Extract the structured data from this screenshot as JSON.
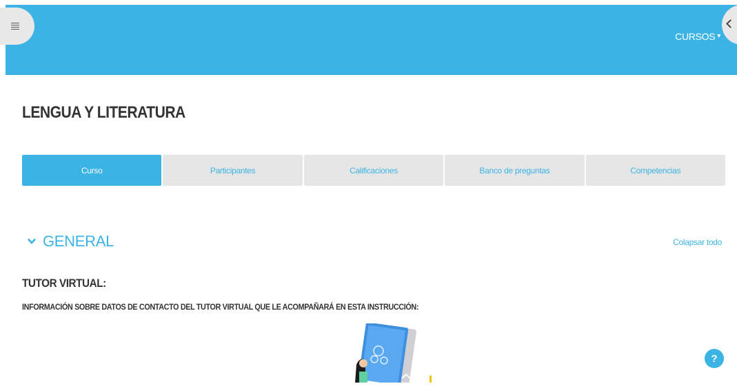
{
  "header": {
    "menu_icon": "list-icon",
    "courses_menu_label": "CURSOS",
    "courses_chevron_icon": "chevron-down-icon",
    "side_handle_icon": "chevron-left-icon",
    "brand_color": "#3bb4e5"
  },
  "page": {
    "title": "LENGUA Y LITERATURA"
  },
  "tabs": [
    {
      "label": "Curso",
      "active": true
    },
    {
      "label": "Participantes",
      "active": false
    },
    {
      "label": "Calificaciones",
      "active": false
    },
    {
      "label": "Banco de preguntas",
      "active": false
    },
    {
      "label": "Competencias",
      "active": false
    }
  ],
  "section": {
    "title": "GENERAL",
    "collapse_all": "Colapsar todo"
  },
  "content": {
    "heading": "TUTOR VIRTUAL:",
    "info": "INFORMACIÓN SOBRE DATOS DE CONTACTO DEL TUTOR VIRTUAL QUE LE ACOMPAÑARÁ EN ESTA INSTRUCCIÓN:"
  },
  "help": {
    "label": "?"
  }
}
